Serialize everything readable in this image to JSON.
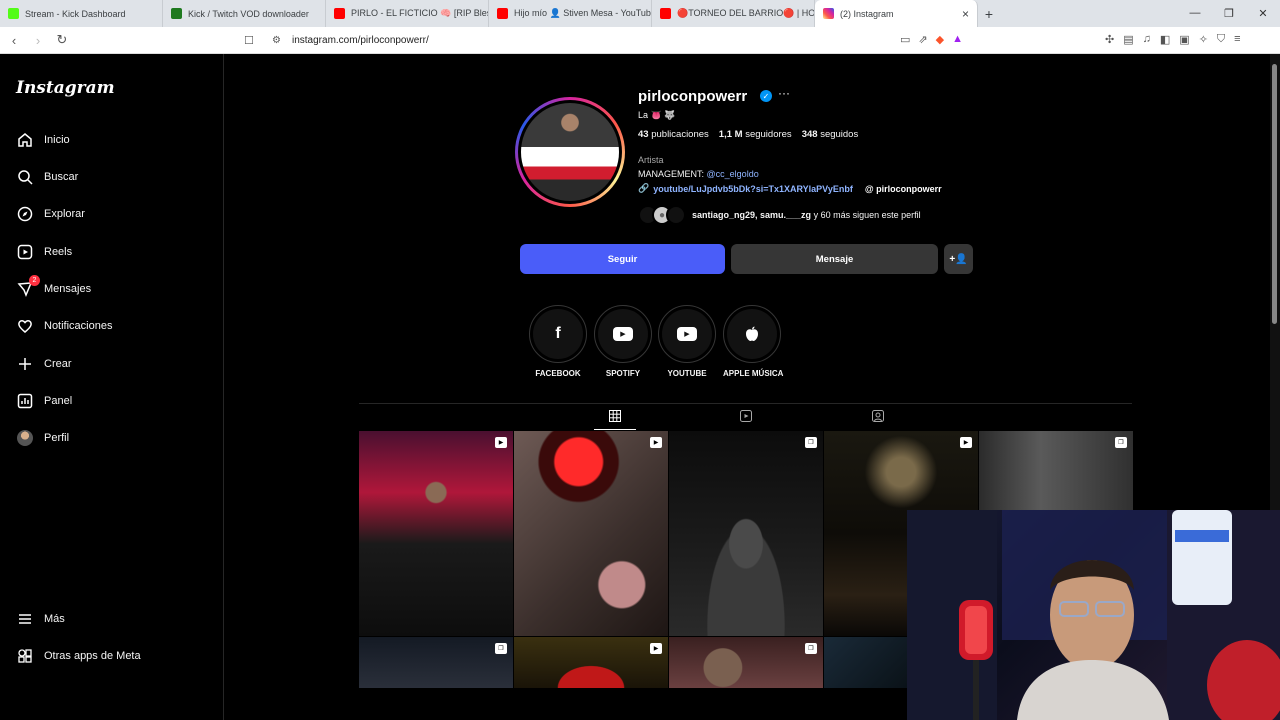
{
  "browser": {
    "tabs": [
      {
        "label": "Stream - Kick Dashboard",
        "fav_color": "#53fc18"
      },
      {
        "label": "Kick / Twitch VOD downloader",
        "fav_color": "#1f7a1f"
      },
      {
        "label": "PIRLO - EL FICTICIO 🧠 [RIP Blessd] |",
        "fav_color": "#ff0000"
      },
      {
        "label": "Hijo mío 👤 Stiven Mesa - YouTube",
        "fav_color": "#ff0000"
      },
      {
        "label": "🔴TORNEO DEL BARRIO🔴 | HOY CE",
        "fav_color": "#ff0000"
      },
      {
        "label": "(2) Instagram",
        "fav_color": "#e1306c"
      }
    ],
    "new_tab": "+",
    "url": "instagram.com/pirloconpowerr/"
  },
  "sidebar": {
    "logo": "Instagram",
    "items": [
      {
        "label": "Inicio",
        "icon": "home-icon",
        "glyph": "⌂"
      },
      {
        "label": "Buscar",
        "icon": "search-icon",
        "glyph": "⌕"
      },
      {
        "label": "Explorar",
        "icon": "compass-icon",
        "glyph": "◎"
      },
      {
        "label": "Reels",
        "icon": "reels-icon",
        "glyph": "▶"
      },
      {
        "label": "Mensajes",
        "icon": "messenger-icon",
        "glyph": "✉",
        "badge": "2"
      },
      {
        "label": "Notificaciones",
        "icon": "heart-icon",
        "glyph": "♡"
      },
      {
        "label": "Crear",
        "icon": "plus-icon",
        "glyph": "+"
      },
      {
        "label": "Panel",
        "icon": "dashboard-icon",
        "glyph": "▥"
      },
      {
        "label": "Perfil",
        "icon": "avatar",
        "glyph": ""
      }
    ],
    "more": "Más",
    "meta_apps": "Otras apps de Meta"
  },
  "profile": {
    "username": "pirloconpowerr",
    "subname": "La 👅 🐺",
    "posts_count": "43",
    "posts_label": "publicaciones",
    "followers_count": "1,1 M",
    "followers_label": "seguidores",
    "following_count": "348",
    "following_label": "seguidos",
    "category": "Artista",
    "bio_prefix": "MANAGEMENT:",
    "bio_mention": "@cc_elgoldo",
    "link": "youtube/LuJpdvb5bDk?si=Tx1XARYlaPVyEnbf",
    "threads": "pirloconpowerr",
    "followed_by_names": "santiago_ng29, samu.___zg",
    "followed_by_rest": "y 60 más siguen este perfil",
    "follow_button": "Seguir",
    "message_button": "Mensaje",
    "add_user_glyph": "+👤"
  },
  "highlights": [
    {
      "label": "FACEBOOK",
      "icon": "facebook-icon",
      "glyph": "f"
    },
    {
      "label": "SPOTIFY",
      "icon": "youtube-icon",
      "glyph": "▶"
    },
    {
      "label": "YOUTUBE",
      "icon": "youtube-icon",
      "glyph": "▶"
    },
    {
      "label": "APPLE MÚSICA",
      "icon": "apple-icon",
      "glyph": ""
    }
  ],
  "profile_tabs": [
    {
      "name": "posts",
      "icon": "grid-icon",
      "glyph": "▦"
    },
    {
      "name": "reels",
      "icon": "reels-icon",
      "glyph": "▣"
    },
    {
      "name": "tagged",
      "icon": "tagged-icon",
      "glyph": "☐"
    }
  ],
  "colors": {
    "follow_button": "#4a5df9",
    "message_button": "#363636",
    "link": "#8fb4ff",
    "verified": "#0095f6"
  }
}
